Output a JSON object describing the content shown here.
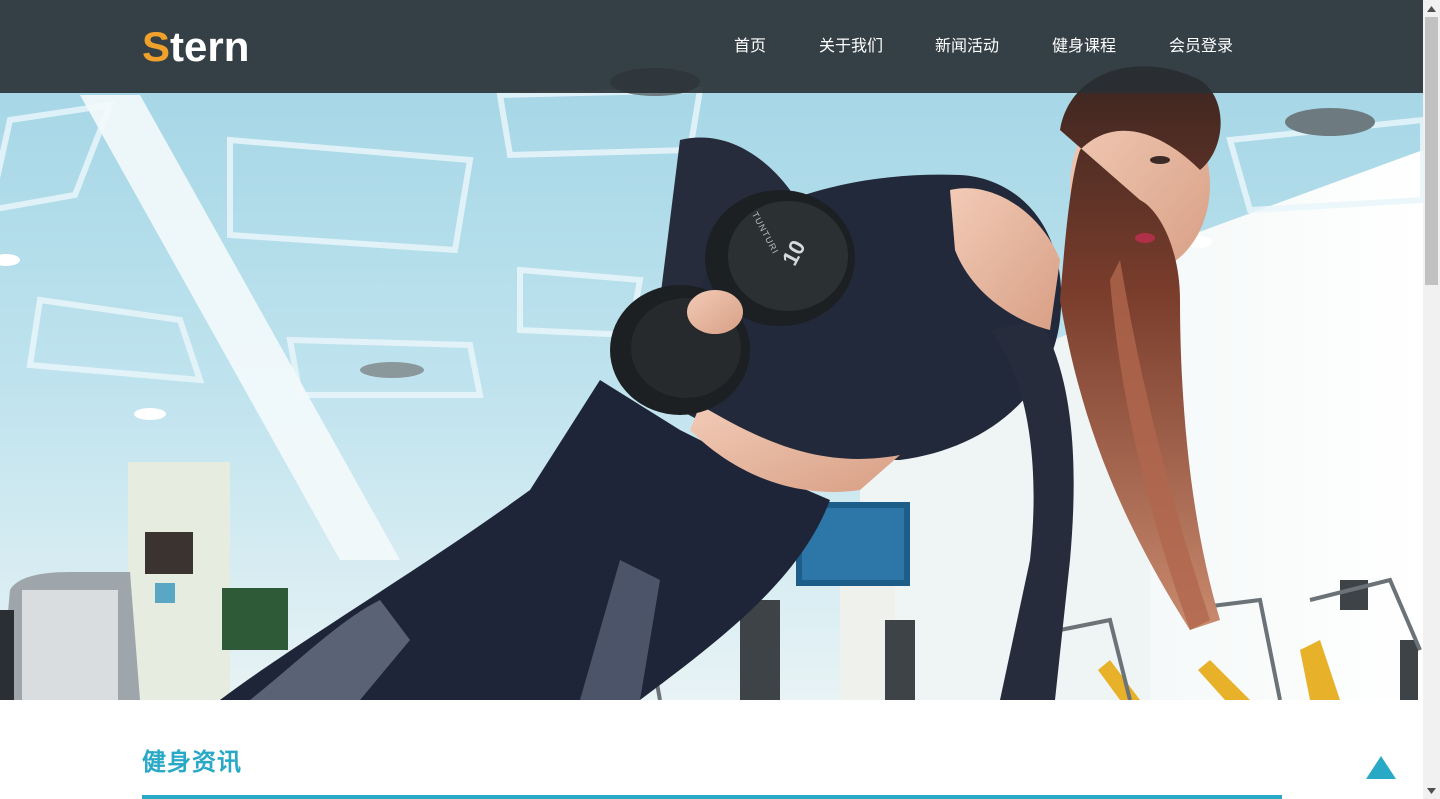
{
  "header": {
    "logo_first_letter": "S",
    "logo_rest": "tern",
    "nav": [
      {
        "label": "首页"
      },
      {
        "label": "关于我们"
      },
      {
        "label": "新闻活动"
      },
      {
        "label": "健身课程"
      },
      {
        "label": "会员登录"
      }
    ]
  },
  "hero": {
    "dumbbell_plate_text": "10",
    "dumbbell_brand_text": "TUNTURI"
  },
  "news_section": {
    "title": "健身资讯"
  },
  "colors": {
    "accent": "#2aa9c6",
    "logo_accent": "#f0a12b",
    "nav_bg": "#283034"
  },
  "icons": {
    "back_to_top": "triangle-up-icon",
    "scroll_up": "scroll-up-arrow-icon",
    "scroll_down": "scroll-down-arrow-icon"
  }
}
